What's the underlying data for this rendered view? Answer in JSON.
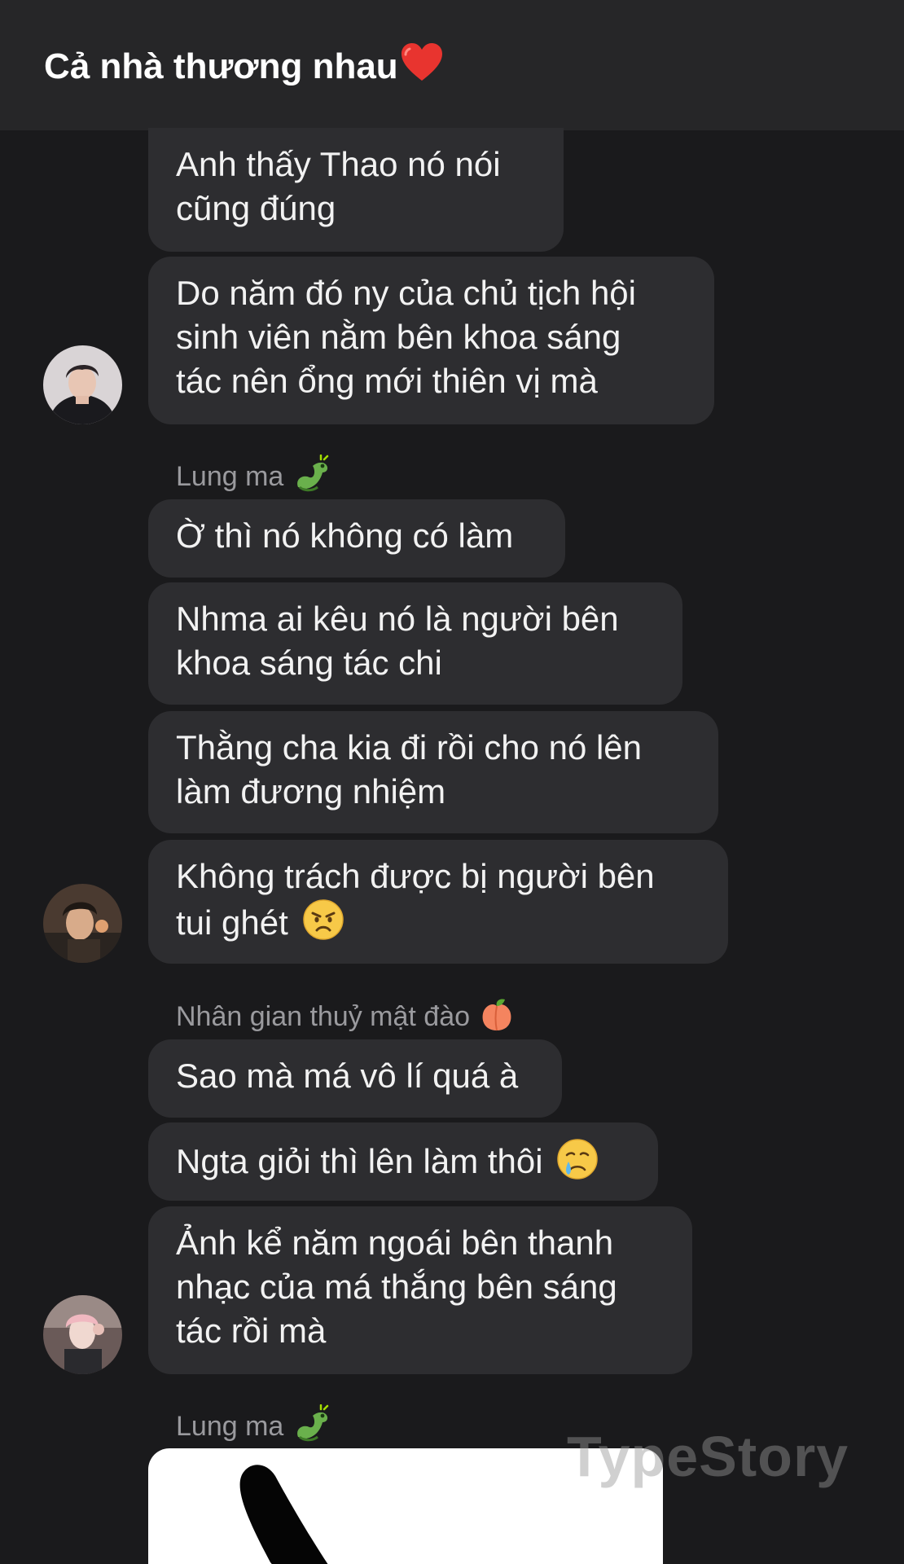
{
  "header": {
    "title": "Cả nhà thương nhau",
    "title_emoji": "heart-emoji"
  },
  "messages": [
    {
      "line1": "Anh thấy Thao nó nói",
      "line2": "cũng đúng"
    },
    {
      "line1": "Do năm đó ny của chủ tịch hội",
      "line2": "sinh viên nằm bên khoa sáng",
      "line3": "tác nên ổng mới thiên vị mà"
    },
    {
      "sender": "Lung ma",
      "sender_emoji": "dragon-emoji"
    },
    {
      "line1": "Ờ thì nó không có làm"
    },
    {
      "line1": "Nhma ai kêu nó là người bên",
      "line2": "khoa sáng tác chi"
    },
    {
      "line1": "Thằng cha kia đi rồi cho nó lên",
      "line2": "làm đương nhiệm"
    },
    {
      "line1": "Không trách được bị người bên",
      "line2": "tui ghét",
      "emoji": "angry-face-emoji"
    },
    {
      "sender": "Nhân gian thuỷ mật đào",
      "sender_emoji": "peach-emoji"
    },
    {
      "line1": "Sao mà má vô lí quá à"
    },
    {
      "line1": "Ngta giỏi thì lên làm thôi",
      "emoji": "crying-face-emoji"
    },
    {
      "line1": "Ảnh kể năm ngoái bên thanh",
      "line2": "nhạc của má thắng bên sáng",
      "line3": "tác rồi mà"
    },
    {
      "sender": "Lung ma",
      "sender_emoji": "dragon-emoji"
    }
  ],
  "watermark": "TypeStory",
  "colors": {
    "background": "#1a1a1c",
    "header": "#262628",
    "bubble": "#2d2d30",
    "text": "#f2f2f2",
    "sender": "#9a9a9e"
  }
}
